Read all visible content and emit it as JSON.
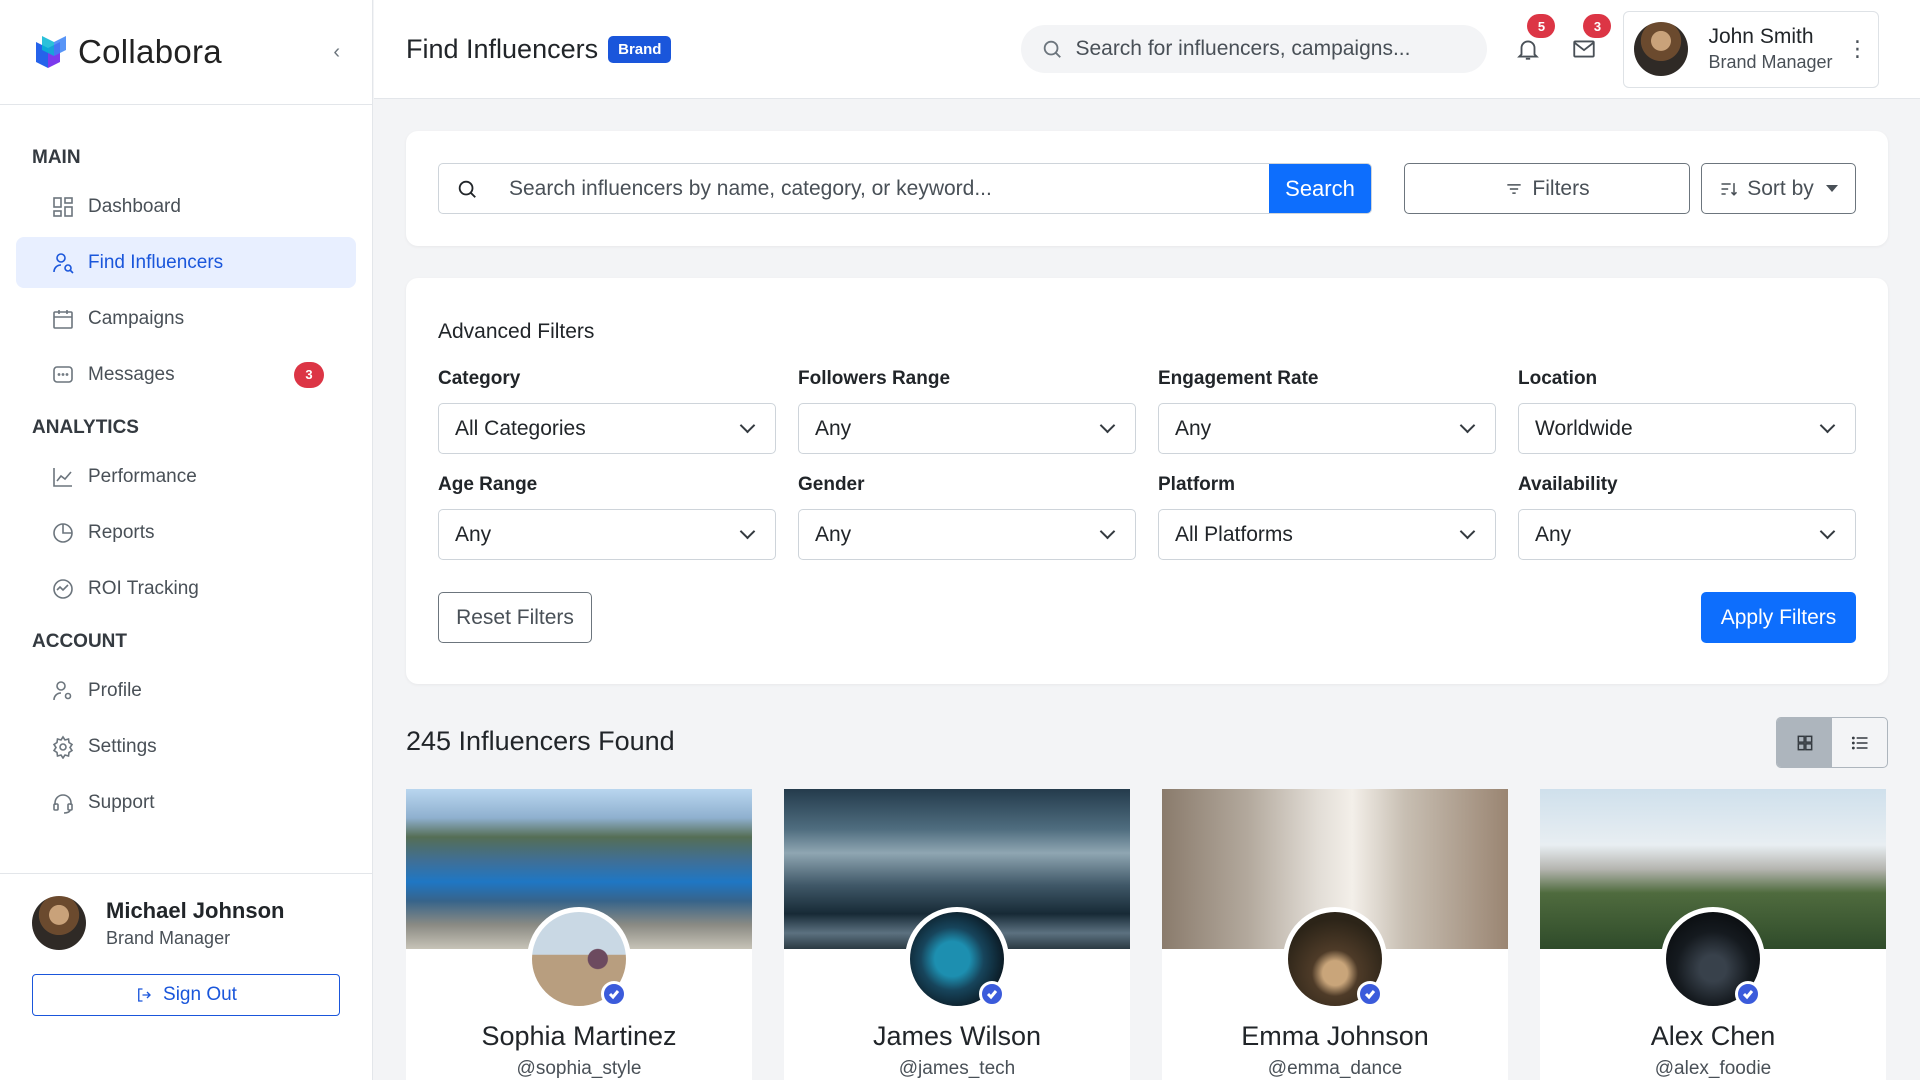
{
  "brand": {
    "name": "Collabora"
  },
  "sidebar": {
    "sections": [
      {
        "title": "MAIN"
      },
      {
        "title": "ANALYTICS"
      },
      {
        "title": "ACCOUNT"
      }
    ],
    "items": [
      {
        "label": "Dashboard"
      },
      {
        "label": "Find Influencers"
      },
      {
        "label": "Campaigns"
      },
      {
        "label": "Messages",
        "badge": "3"
      },
      {
        "label": "Performance"
      },
      {
        "label": "Reports"
      },
      {
        "label": "ROI Tracking"
      },
      {
        "label": "Profile"
      },
      {
        "label": "Settings"
      },
      {
        "label": "Support"
      }
    ],
    "user": {
      "name": "Michael Johnson",
      "role": "Brand Manager"
    },
    "signout_label": "Sign Out"
  },
  "header": {
    "title": "Find Influencers",
    "badge": "Brand",
    "search_placeholder": "Search for influencers, campaigns...",
    "notifications_count": "5",
    "messages_count": "3",
    "user": {
      "name": "John Smith",
      "role": "Brand Manager"
    }
  },
  "search": {
    "placeholder": "Search influencers by name, category, or keyword...",
    "button": "Search",
    "filters_label": "Filters",
    "sort_label": "Sort by"
  },
  "advanced": {
    "title": "Advanced Filters",
    "filters": [
      {
        "label": "Category",
        "value": "All Categories"
      },
      {
        "label": "Followers Range",
        "value": "Any"
      },
      {
        "label": "Engagement Rate",
        "value": "Any"
      },
      {
        "label": "Location",
        "value": "Worldwide"
      },
      {
        "label": "Age Range",
        "value": "Any"
      },
      {
        "label": "Gender",
        "value": "Any"
      },
      {
        "label": "Platform",
        "value": "All Platforms"
      },
      {
        "label": "Availability",
        "value": "Any"
      }
    ],
    "reset_label": "Reset Filters",
    "apply_label": "Apply Filters"
  },
  "results": {
    "title": "245 Influencers Found",
    "influencers": [
      {
        "name": "Sophia Martinez",
        "handle": "@sophia_style"
      },
      {
        "name": "James Wilson",
        "handle": "@james_tech"
      },
      {
        "name": "Emma Johnson",
        "handle": "@emma_dance"
      },
      {
        "name": "Alex Chen",
        "handle": "@alex_foodie"
      }
    ]
  },
  "colors": {
    "primary": "#0d6efd",
    "brand_blue": "#1a56db",
    "badge_red": "#dc3545",
    "active_bg": "#e8efff"
  }
}
